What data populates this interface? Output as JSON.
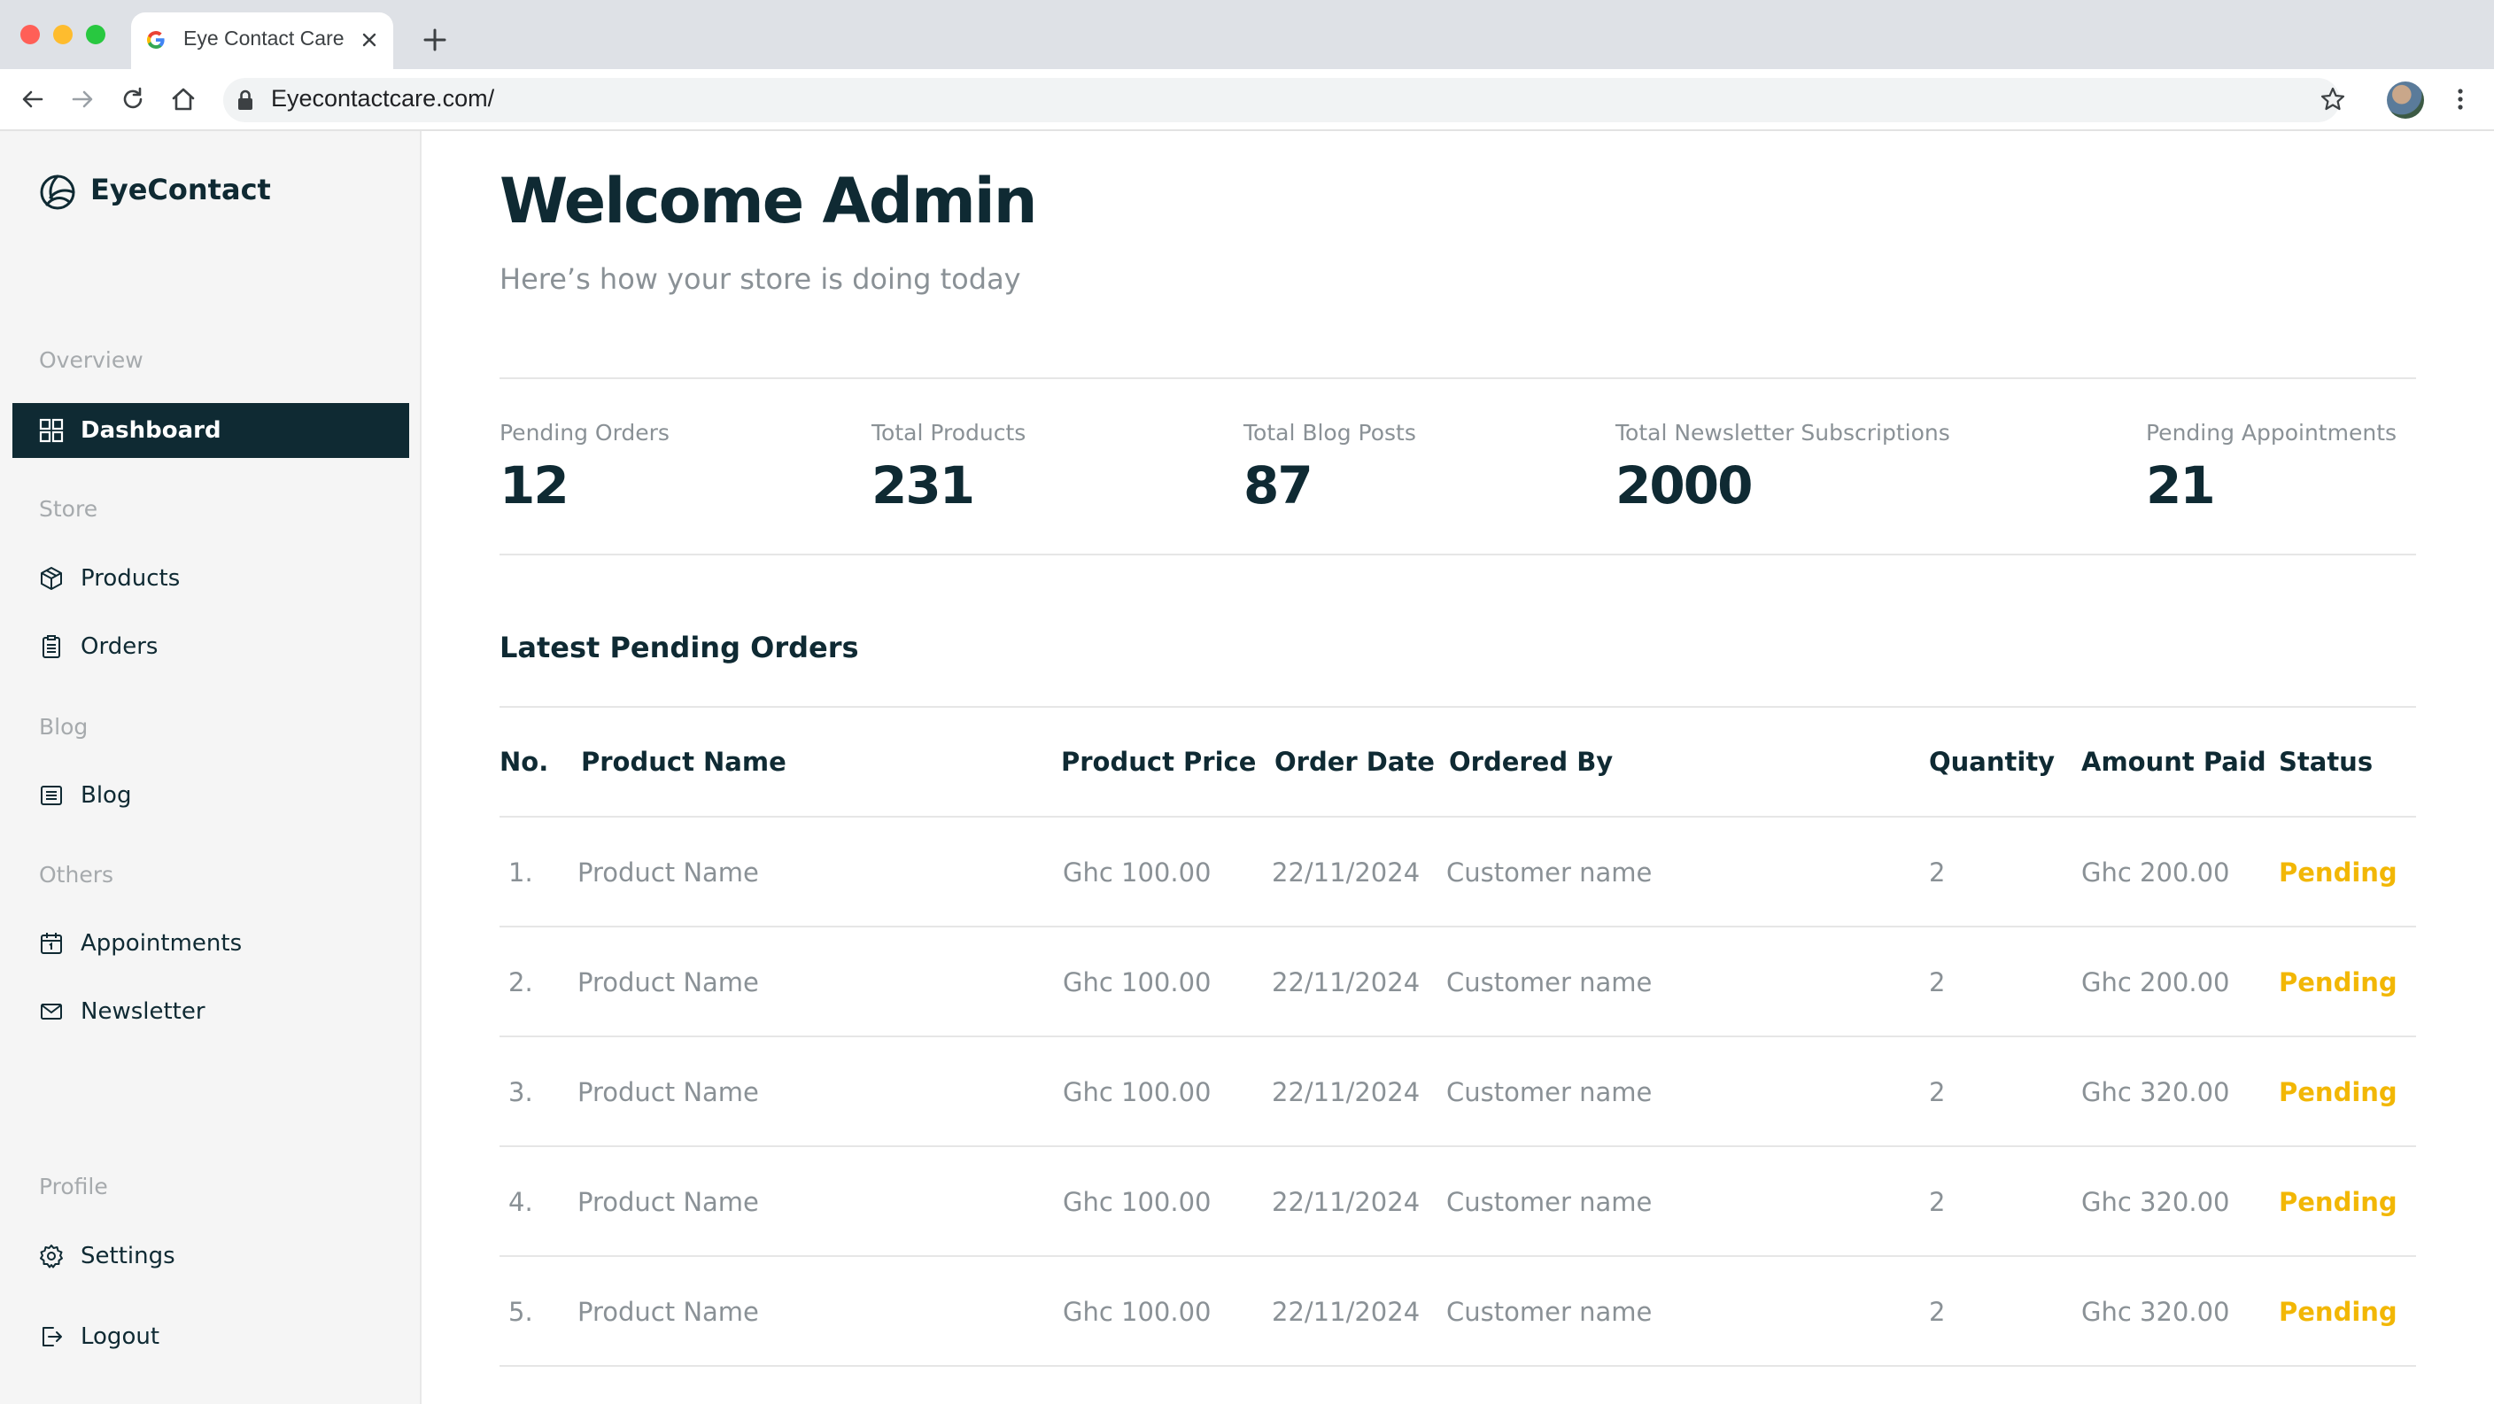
{
  "browser": {
    "tab_title": "Eye Contact Care",
    "url": "Eyecontactcare.com/"
  },
  "sidebar": {
    "brand": "EyeContact",
    "sections": {
      "overview": "Overview",
      "store": "Store",
      "blog": "Blog",
      "others": "Others",
      "profile": "Profile"
    },
    "items": {
      "dashboard": "Dashboard",
      "products": "Products",
      "orders": "Orders",
      "blog": "Blog",
      "appointments": "Appointments",
      "newsletter": "Newsletter",
      "settings": "Settings",
      "logout": "Logout"
    },
    "active_item": "dashboard"
  },
  "main": {
    "title": "Welcome Admin",
    "subtitle": "Here’s how your store is doing today",
    "stats": [
      {
        "label": "Pending Orders",
        "value": "12"
      },
      {
        "label": "Total Products",
        "value": "231"
      },
      {
        "label": "Total Blog Posts",
        "value": "87"
      },
      {
        "label": "Total Newsletter Subscriptions",
        "value": "2000"
      },
      {
        "label": "Pending Appointments",
        "value": "21"
      }
    ],
    "orders_title": "Latest Pending Orders",
    "columns": [
      "No.",
      "Product Name",
      "Product Price",
      "Order Date",
      "Ordered By",
      "Quantity",
      "Amount Paid",
      "Status"
    ],
    "rows": [
      {
        "no": "1.",
        "product": "Product Name",
        "price": "Ghc 100.00",
        "date": "22/11/2024",
        "by": "Customer name",
        "qty": "2",
        "amount": "Ghc 200.00",
        "status": "Pending"
      },
      {
        "no": "2.",
        "product": "Product Name",
        "price": "Ghc 100.00",
        "date": "22/11/2024",
        "by": "Customer name",
        "qty": "2",
        "amount": "Ghc 200.00",
        "status": "Pending"
      },
      {
        "no": "3.",
        "product": "Product Name",
        "price": "Ghc 100.00",
        "date": "22/11/2024",
        "by": "Customer name",
        "qty": "2",
        "amount": "Ghc 320.00",
        "status": "Pending"
      },
      {
        "no": "4.",
        "product": "Product Name",
        "price": "Ghc 100.00",
        "date": "22/11/2024",
        "by": "Customer name",
        "qty": "2",
        "amount": "Ghc 320.00",
        "status": "Pending"
      },
      {
        "no": "5.",
        "product": "Product Name",
        "price": "Ghc 100.00",
        "date": "22/11/2024",
        "by": "Customer name",
        "qty": "2",
        "amount": "Ghc 320.00",
        "status": "Pending"
      }
    ]
  },
  "colors": {
    "brand_dark": "#0f2a33",
    "status_pending": "#f2b705",
    "muted_text": "#8a9196"
  }
}
